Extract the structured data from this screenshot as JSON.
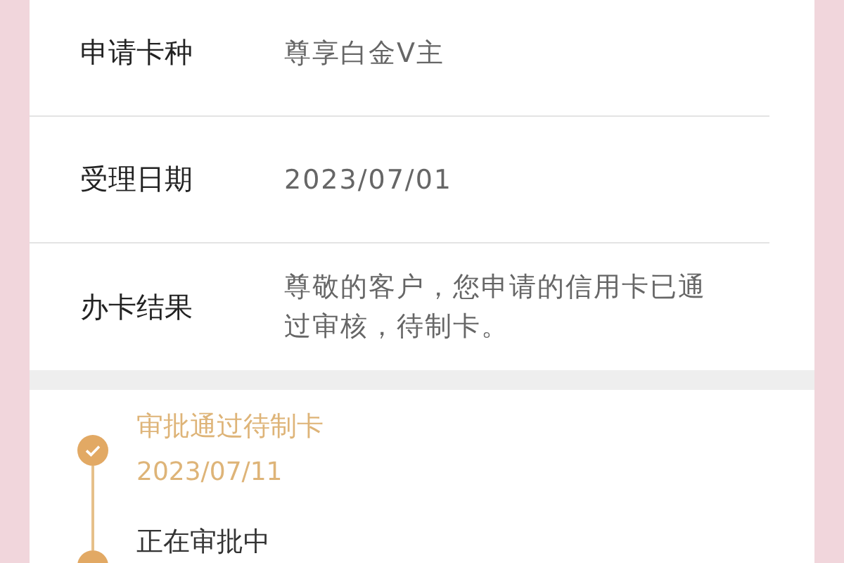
{
  "details": [
    {
      "label": "申请卡种",
      "value": "尊享白金V主"
    },
    {
      "label": "受理日期",
      "value": "2023/07/01"
    },
    {
      "label": "办卡结果",
      "value": "尊敬的客户，您申请的信用卡已通过审核，待制卡。"
    }
  ],
  "progress": [
    {
      "kind": "done",
      "title": "审批通过待制卡",
      "date": "2023/07/11"
    },
    {
      "kind": "current",
      "title": "正在审批中"
    }
  ]
}
